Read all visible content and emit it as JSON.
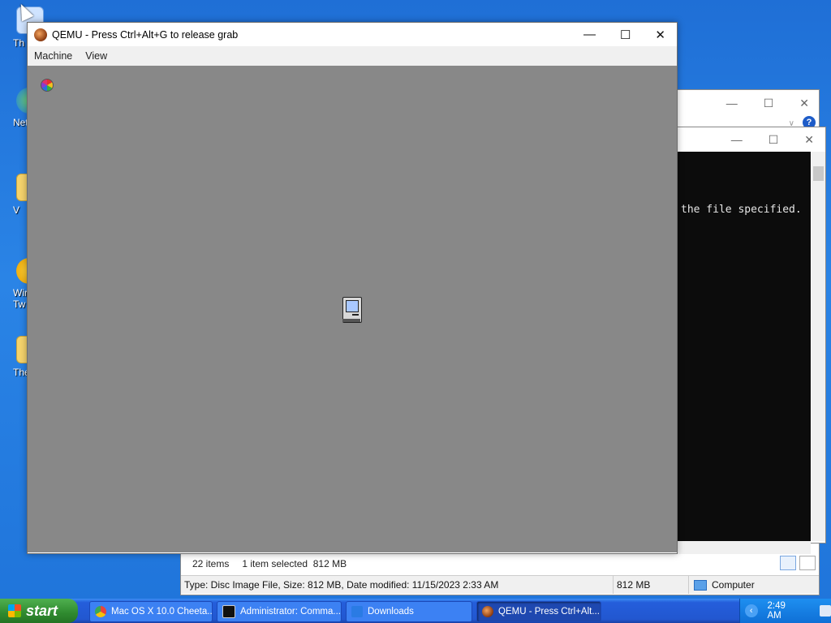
{
  "desktop": {
    "icons": [
      {
        "label": "Th"
      },
      {
        "label": "Net"
      },
      {
        "label": "V"
      },
      {
        "label": "Wir\nTw"
      },
      {
        "label": "The.C"
      }
    ]
  },
  "explorer": {
    "status": {
      "items_count": "22 items",
      "selected": "1 item selected  812 MB",
      "details": "Type: Disc Image File, Size: 812 MB, Date modified: 11/15/2023 2:33 AM",
      "size": "812 MB",
      "location": "Computer"
    }
  },
  "cmd": {
    "console_line": "the file specified."
  },
  "qemu": {
    "title": "QEMU - Press Ctrl+Alt+G to release grab",
    "menu": [
      "Machine",
      "View"
    ]
  },
  "taskbar": {
    "start_label": "start",
    "tasks": [
      {
        "label": "Mac OS X 10.0 Cheeta...",
        "icon": "chrome-icon",
        "color": "#e8453c"
      },
      {
        "label": "Administrator: Comma...",
        "icon": "cmd-icon",
        "color": "#111111"
      },
      {
        "label": "Downloads",
        "icon": "download-icon",
        "color": "#2a7be4"
      },
      {
        "label": "QEMU - Press Ctrl+Alt...",
        "icon": "qemu-icon",
        "color": "#b0501c"
      }
    ],
    "clock": "2:49 AM"
  }
}
